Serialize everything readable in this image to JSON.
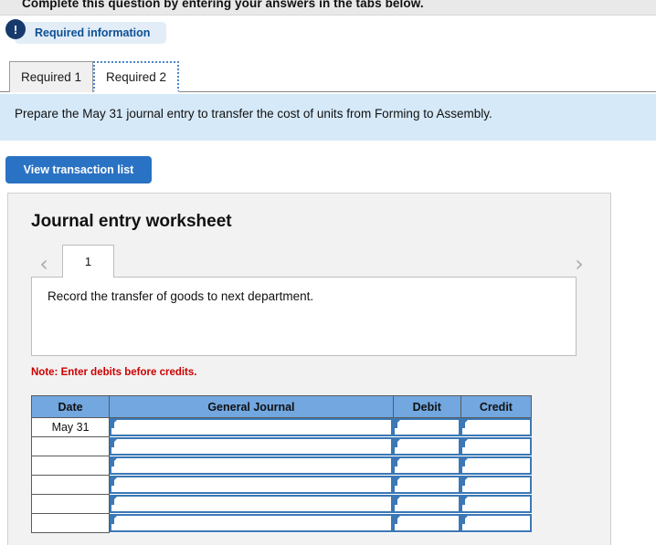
{
  "banner": {
    "text": "Complete this question by entering your answers in the tabs below."
  },
  "required_info": {
    "icon_glyph": "!",
    "label": "Required information"
  },
  "tabs": [
    {
      "label": "Required 1",
      "active": false
    },
    {
      "label": "Required 2",
      "active": true
    }
  ],
  "instruction": {
    "text": "Prepare the May 31 journal entry to transfer the cost of units from Forming to Assembly."
  },
  "toolbar": {
    "view_transaction_list_label": "View transaction list"
  },
  "worksheet": {
    "title": "Journal entry worksheet",
    "prev_arrow": "‹",
    "next_arrow": "›",
    "page_tab": "1",
    "description": "Record the transfer of goods to next department.",
    "note": "Note: Enter debits before credits.",
    "table": {
      "headers": [
        "Date",
        "General Journal",
        "Debit",
        "Credit"
      ],
      "rows": [
        {
          "date": "May 31",
          "general_journal": "",
          "debit": "",
          "credit": ""
        },
        {
          "date": "",
          "general_journal": "",
          "debit": "",
          "credit": ""
        },
        {
          "date": "",
          "general_journal": "",
          "debit": "",
          "credit": ""
        },
        {
          "date": "",
          "general_journal": "",
          "debit": "",
          "credit": ""
        },
        {
          "date": "",
          "general_journal": "",
          "debit": "",
          "credit": ""
        },
        {
          "date": "",
          "general_journal": "",
          "debit": "",
          "credit": ""
        }
      ]
    }
  },
  "colors": {
    "accent_blue": "#2a72c4",
    "header_blue": "#72a7e0",
    "panel_blue": "#d6e9f8",
    "badge_navy": "#173a6d",
    "note_red": "#cc0000",
    "input_border": "#3b78b5"
  }
}
